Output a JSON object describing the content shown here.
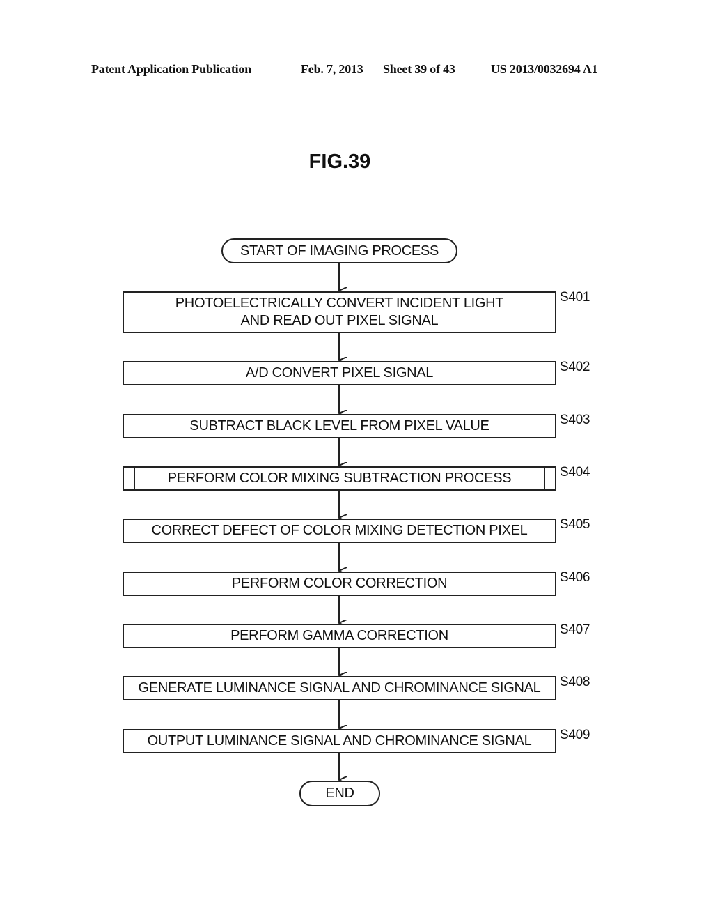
{
  "header": {
    "publication": "Patent Application Publication",
    "date": "Feb. 7, 2013",
    "sheet": "Sheet 39 of 43",
    "number": "US 2013/0032694 A1"
  },
  "figure": {
    "title": "FIG.39"
  },
  "flowchart": {
    "start": "START OF IMAGING PROCESS",
    "end": "END",
    "steps": [
      {
        "id": "S401",
        "lines": [
          "PHOTOELECTRICALLY CONVERT INCIDENT LIGHT",
          "AND READ OUT PIXEL SIGNAL"
        ],
        "subroutine": false
      },
      {
        "id": "S402",
        "lines": [
          "A/D CONVERT PIXEL SIGNAL"
        ],
        "subroutine": false
      },
      {
        "id": "S403",
        "lines": [
          "SUBTRACT BLACK LEVEL FROM PIXEL VALUE"
        ],
        "subroutine": false
      },
      {
        "id": "S404",
        "lines": [
          "PERFORM COLOR MIXING SUBTRACTION PROCESS"
        ],
        "subroutine": true
      },
      {
        "id": "S405",
        "lines": [
          "CORRECT DEFECT OF COLOR MIXING DETECTION PIXEL"
        ],
        "subroutine": false
      },
      {
        "id": "S406",
        "lines": [
          "PERFORM COLOR CORRECTION"
        ],
        "subroutine": false
      },
      {
        "id": "S407",
        "lines": [
          "PERFORM GAMMA CORRECTION"
        ],
        "subroutine": false
      },
      {
        "id": "S408",
        "lines": [
          "GENERATE LUMINANCE SIGNAL AND CHROMINANCE SIGNAL"
        ],
        "subroutine": false
      },
      {
        "id": "S409",
        "lines": [
          "OUTPUT LUMINANCE SIGNAL AND CHROMINANCE SIGNAL"
        ],
        "subroutine": false
      }
    ]
  }
}
